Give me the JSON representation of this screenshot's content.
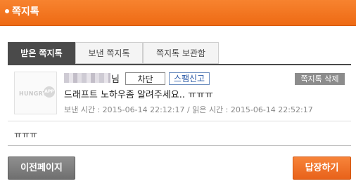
{
  "header": {
    "title": "쪽지톡"
  },
  "tabs": [
    {
      "label": "받은 쪽지톡",
      "active": true
    },
    {
      "label": "보낸 쪽지톡",
      "active": false
    },
    {
      "label": "쪽지톡 보관함",
      "active": false
    }
  ],
  "message": {
    "sender_suffix": "님",
    "avatar_brand": "HUNGRY",
    "avatar_badge": "APP",
    "block_label": "차단",
    "spam_label": "스팸신고",
    "delete_label": "쪽지톡 삭제",
    "subject": "드래프트 노하우좀 알려주세요.. ㅠㅠㅠ",
    "meta": "보낸 시간 : 2015-06-14 22:12:17 / 읽은 시간 : 2015-06-14 22:52:17",
    "body": "ㅠㅠㅠ"
  },
  "footer": {
    "prev_label": "이전페이지",
    "reply_label": "답장하기"
  },
  "colors": {
    "header": "#ee6a14",
    "tab_active": "#4a4a4a",
    "reply_button": "#e8621a",
    "prev_button": "#7a7a7a"
  }
}
